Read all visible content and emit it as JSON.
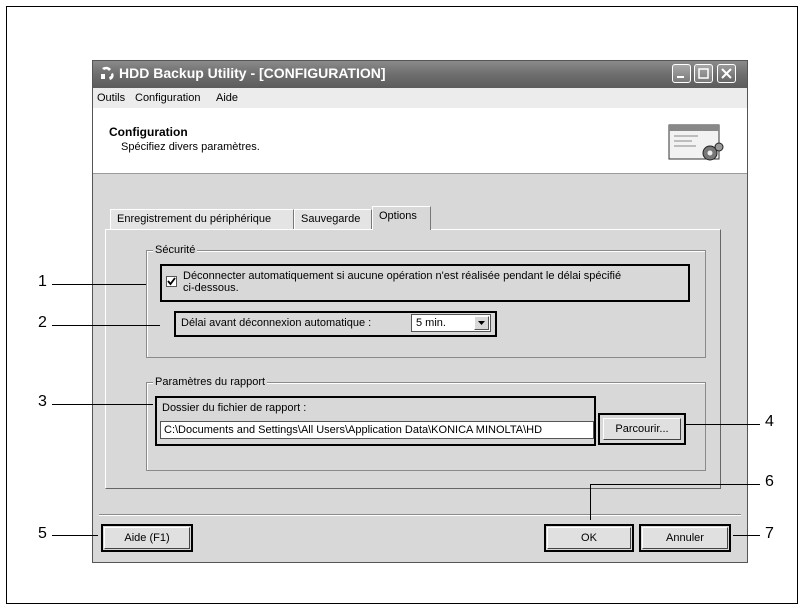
{
  "window": {
    "title": "HDD Backup Utility - [CONFIGURATION]",
    "app_icon": "backup-utility-icon"
  },
  "menubar": {
    "items": [
      "Outils",
      "Configuration",
      "Aide"
    ]
  },
  "header": {
    "title": "Configuration",
    "subtitle": "Spécifiez divers paramètres.",
    "icon": "configuration-gear-icon"
  },
  "tabs": [
    {
      "label": "Enregistrement du périphérique",
      "active": false
    },
    {
      "label": "Sauvegarde",
      "active": false
    },
    {
      "label": "Options",
      "active": true
    }
  ],
  "security": {
    "group_label": "Sécurité",
    "auto_disconnect_checked": true,
    "auto_disconnect_label_line1": "Déconnecter automatiquement si aucune opération n'est réalisée pendant le délai spécifié",
    "auto_disconnect_label_line2": "ci-dessous.",
    "delay_label": "Délai avant déconnexion automatique :",
    "delay_value": "5 min."
  },
  "report": {
    "group_label": "Paramètres du rapport",
    "folder_label": "Dossier du fichier de rapport :",
    "folder_value": "C:\\Documents and Settings\\All Users\\Application Data\\KONICA MINOLTA\\HD",
    "browse_label": "Parcourir..."
  },
  "footer": {
    "help_label": "Aide (F1)",
    "ok_label": "OK",
    "cancel_label": "Annuler"
  },
  "callouts": [
    "1",
    "2",
    "3",
    "4",
    "5",
    "6",
    "7"
  ]
}
